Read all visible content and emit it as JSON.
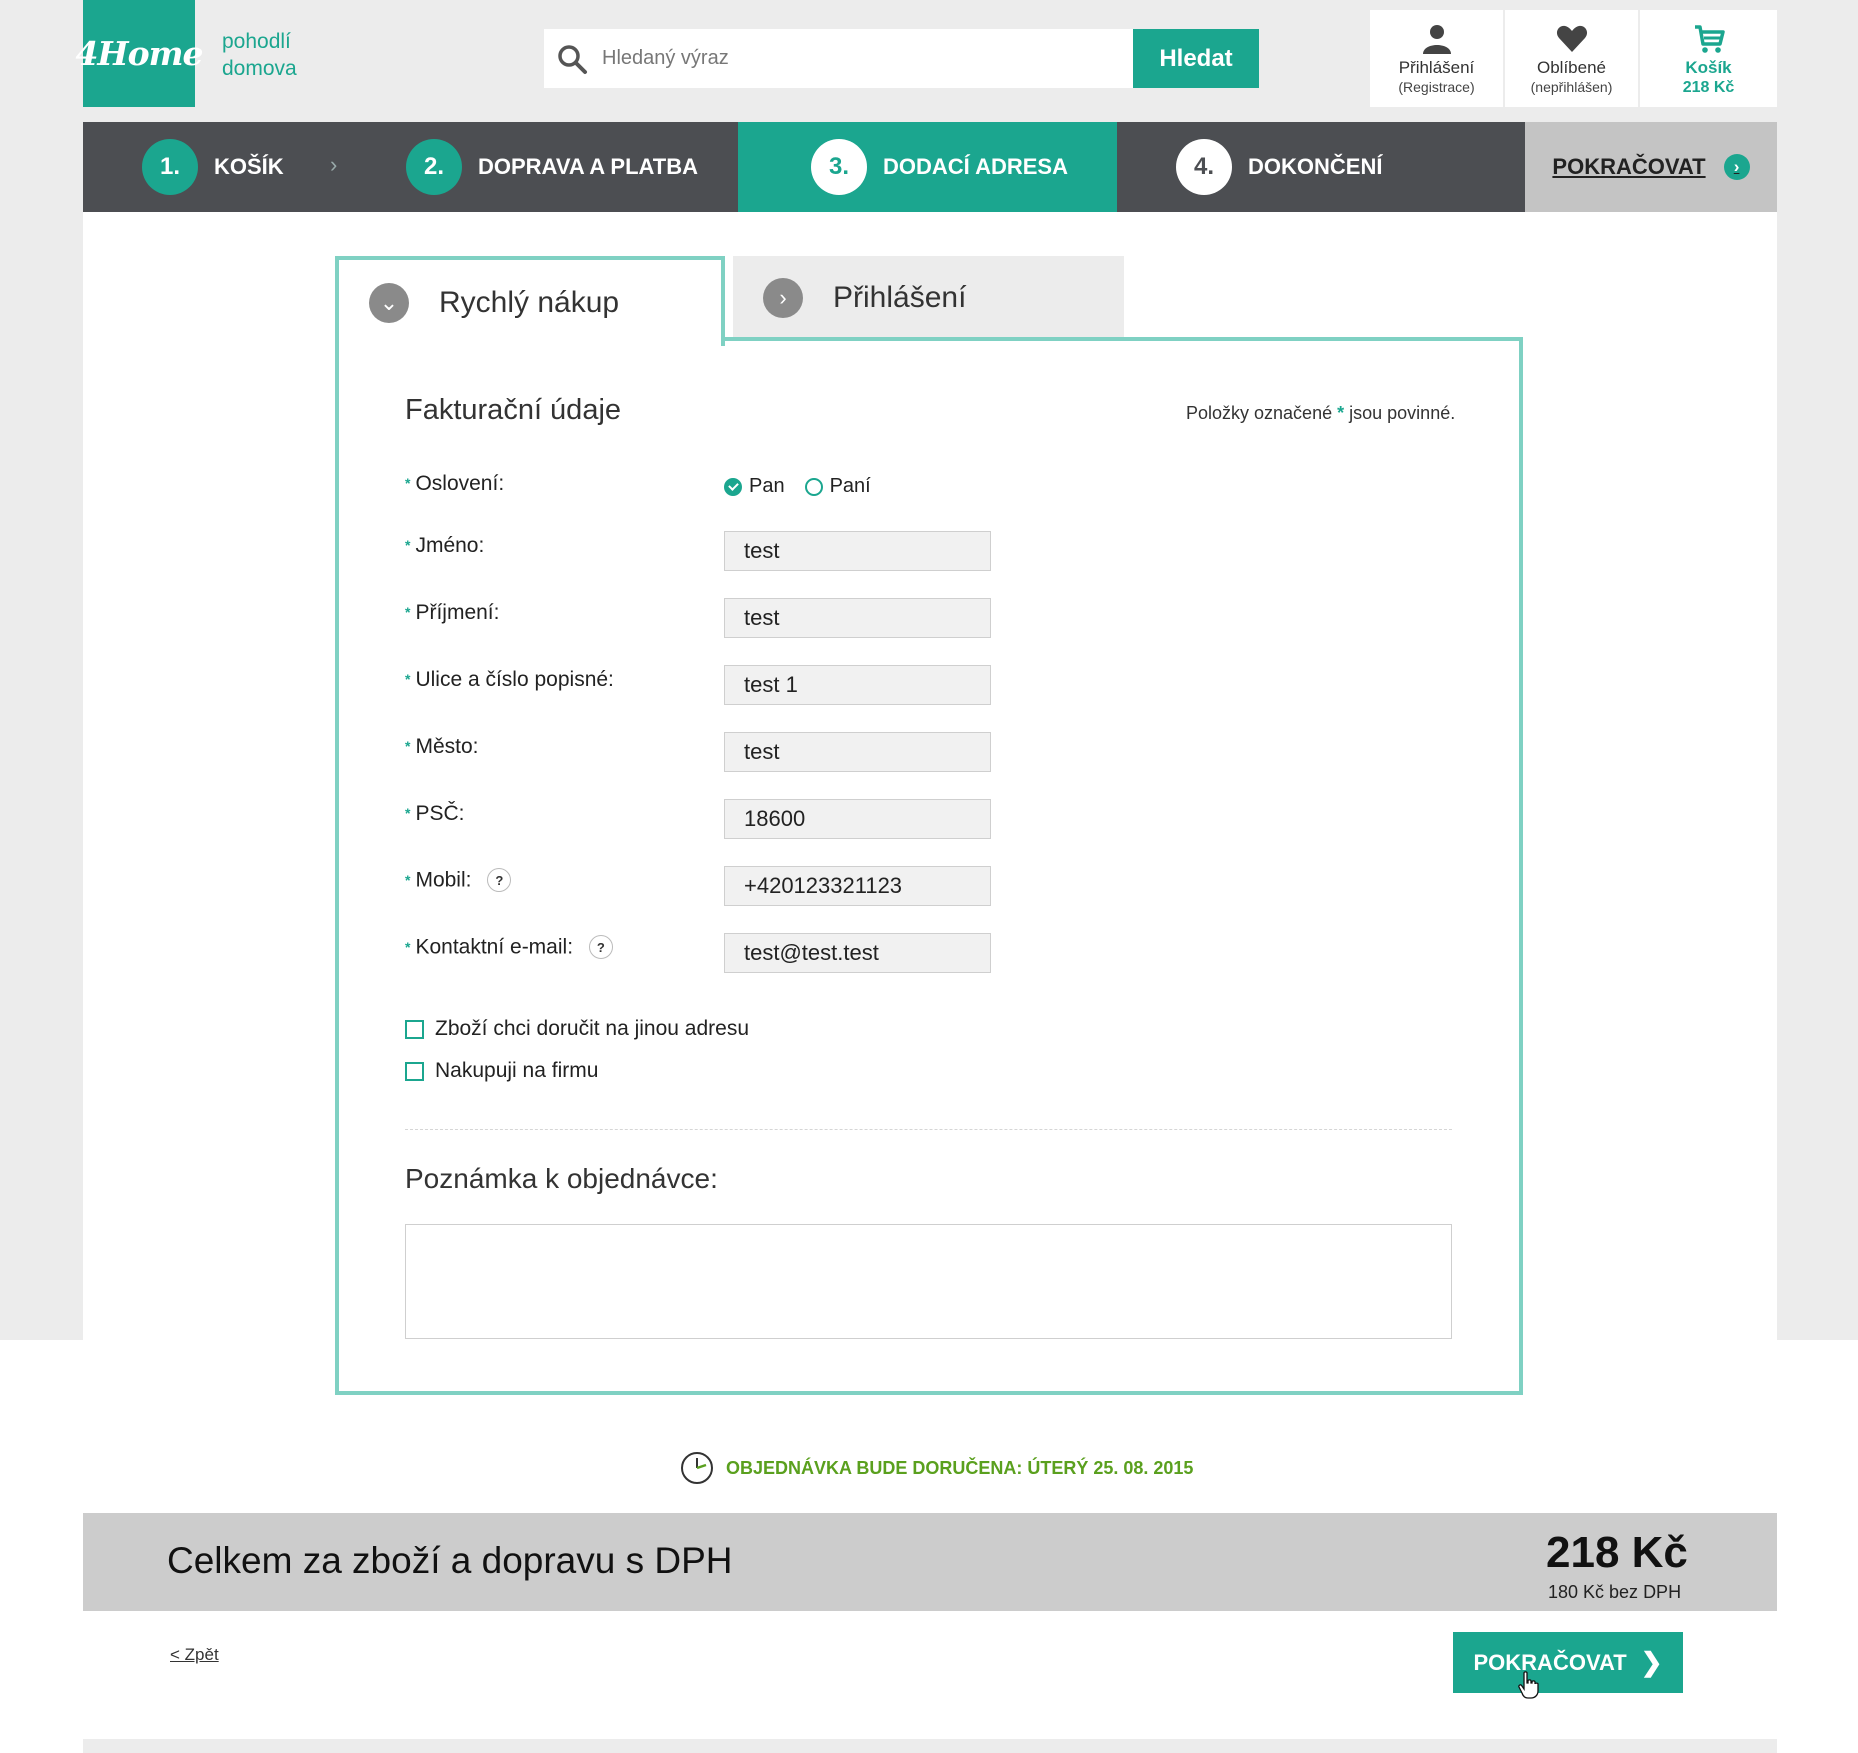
{
  "header": {
    "logo": "4Home",
    "tagline": "pohodlí domova",
    "search_placeholder": "Hledaný výraz",
    "search_button": "Hledat",
    "login": {
      "label": "Přihlášení",
      "sub": "(Registrace)",
      "icon": "user-icon"
    },
    "favorites": {
      "label": "Oblíbené",
      "sub": "(nepřihlášen)",
      "icon": "heart-icon"
    },
    "cart": {
      "label": "Košík",
      "price": "218 Kč",
      "icon": "cart-icon"
    }
  },
  "steps": [
    {
      "num": "1.",
      "label": "KOŠÍK",
      "state": "done"
    },
    {
      "num": "2.",
      "label": "DOPRAVA A PLATBA",
      "state": "done"
    },
    {
      "num": "3.",
      "label": "DODACÍ ADRESA",
      "state": "active"
    },
    {
      "num": "4.",
      "label": "DOKONČENÍ",
      "state": "future"
    }
  ],
  "steps_continue": "POKRAČOVAT",
  "tabs": [
    {
      "label": "Rychlý nákup",
      "active": true
    },
    {
      "label": "Přihlášení",
      "active": false
    }
  ],
  "form": {
    "title": "Fakturační údaje",
    "required_note_before": "Položky označené",
    "required_note_star": "*",
    "required_note_after": "jsou povinné.",
    "salutation_label": "Oslovení:",
    "salutation_options": [
      "Pan",
      "Paní"
    ],
    "salutation_selected": "Pan",
    "fields": [
      {
        "label": "Jméno:",
        "value": "test"
      },
      {
        "label": "Příjmení:",
        "value": "test"
      },
      {
        "label": "Ulice a číslo popisné:",
        "value": "test 1"
      },
      {
        "label": "Město:",
        "value": "test"
      },
      {
        "label": "PSČ:",
        "value": "18600"
      },
      {
        "label": "Mobil:",
        "value": "+420123321123",
        "help": "?"
      },
      {
        "label": "Kontaktní e-mail:",
        "value": "test@test.test",
        "help": "?"
      }
    ],
    "checkboxes": [
      "Zboží chci doručit na jinou adresu",
      "Nakupuji na firmu"
    ],
    "note_title": "Poznámka k objednávce:",
    "note_value": ""
  },
  "delivery_text": "OBJEDNÁVKA BUDE DORUČENA: ÚTERÝ 25. 08. 2015",
  "totals": {
    "label": "Celkem za zboží a dopravu s DPH",
    "price": "218 Kč",
    "price_net": "180 Kč bez DPH"
  },
  "footer": {
    "back": "< Zpět",
    "continue": "POKRAČOVAT"
  },
  "colors": {
    "accent": "#1ba68f",
    "tab_border": "#7fd1c3",
    "steps_bg": "#4c4e52",
    "delivery": "#5aa01e"
  }
}
